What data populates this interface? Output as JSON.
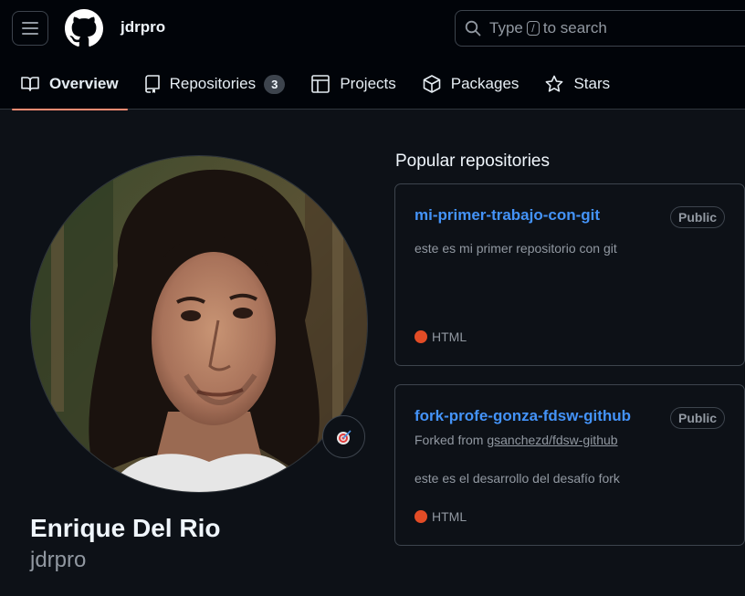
{
  "header": {
    "username": "jdrpro",
    "search": {
      "prefix": "Type",
      "key": "/",
      "suffix": "to search"
    }
  },
  "tabs": [
    {
      "label": "Overview",
      "icon": "book-icon",
      "active": true
    },
    {
      "label": "Repositories",
      "icon": "repo-icon",
      "count": "3"
    },
    {
      "label": "Projects",
      "icon": "table-icon"
    },
    {
      "label": "Packages",
      "icon": "package-icon"
    },
    {
      "label": "Stars",
      "icon": "star-icon"
    }
  ],
  "profile": {
    "full_name": "Enrique Del Rio",
    "login": "jdrpro",
    "status_icon": "target-emoji-icon"
  },
  "popular": {
    "title": "Popular repositories",
    "repos": [
      {
        "name": "mi-primer-trabajo-con-git",
        "visibility": "Public",
        "description": "este es mi primer repositorio con git",
        "language": "HTML",
        "language_color": "#e34c26"
      },
      {
        "name": "fork-profe-gonza-fdsw-github",
        "visibility": "Public",
        "forked_prefix": "Forked from",
        "forked_from": "gsanchezd/fdsw-github",
        "description": "este es el desarrollo del desafío fork",
        "language": "HTML",
        "language_color": "#e34c26"
      }
    ]
  },
  "colors": {
    "background": "#0d1117",
    "header_bg": "#010409",
    "link": "#4493f8",
    "active_tab_underline": "#fd8c73",
    "muted": "#9198a1"
  }
}
